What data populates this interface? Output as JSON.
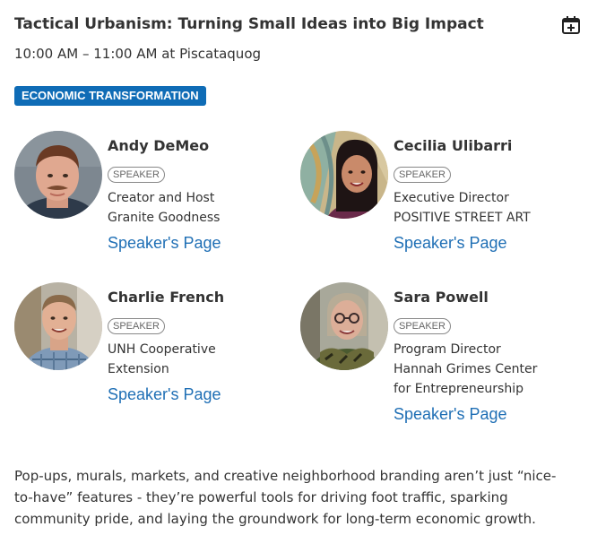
{
  "session": {
    "title": "Tactical Urbanism: Turning Small Ideas into Big Impact",
    "time": "10:00 AM – 11:00 AM",
    "location_prefix": "at",
    "location": "Piscataquog",
    "add_to_calendar_icon": "calendar-plus-icon",
    "tag": "ECONOMIC TRANSFORMATION",
    "tag_color": "#0f6cb6"
  },
  "speakers": [
    {
      "name": "Andy DeMeo",
      "role": "SPEAKER",
      "lines": [
        "Creator and Host",
        "Granite Goodness"
      ],
      "link": "Speaker's Page"
    },
    {
      "name": "Cecilia Ulibarri",
      "role": "SPEAKER",
      "lines": [
        "Executive Director",
        "POSITIVE STREET ART"
      ],
      "link": "Speaker's Page"
    },
    {
      "name": "Charlie French",
      "role": "SPEAKER",
      "lines": [
        "UNH Cooperative",
        "Extension"
      ],
      "link": "Speaker's Page"
    },
    {
      "name": "Sara Powell",
      "role": "SPEAKER",
      "lines": [
        "Program Director",
        "Hannah Grimes Center",
        "for Entrepreneurship"
      ],
      "link": "Speaker's Page"
    }
  ],
  "description": "Pop-ups, murals, markets, and creative neighborhood branding aren’t just “nice-to-have” features - they’re powerful tools for driving foot traffic, sparking community pride, and laying the groundwork for long-term economic growth.",
  "colors": {
    "link": "#1f6fb5",
    "text": "#333333"
  }
}
